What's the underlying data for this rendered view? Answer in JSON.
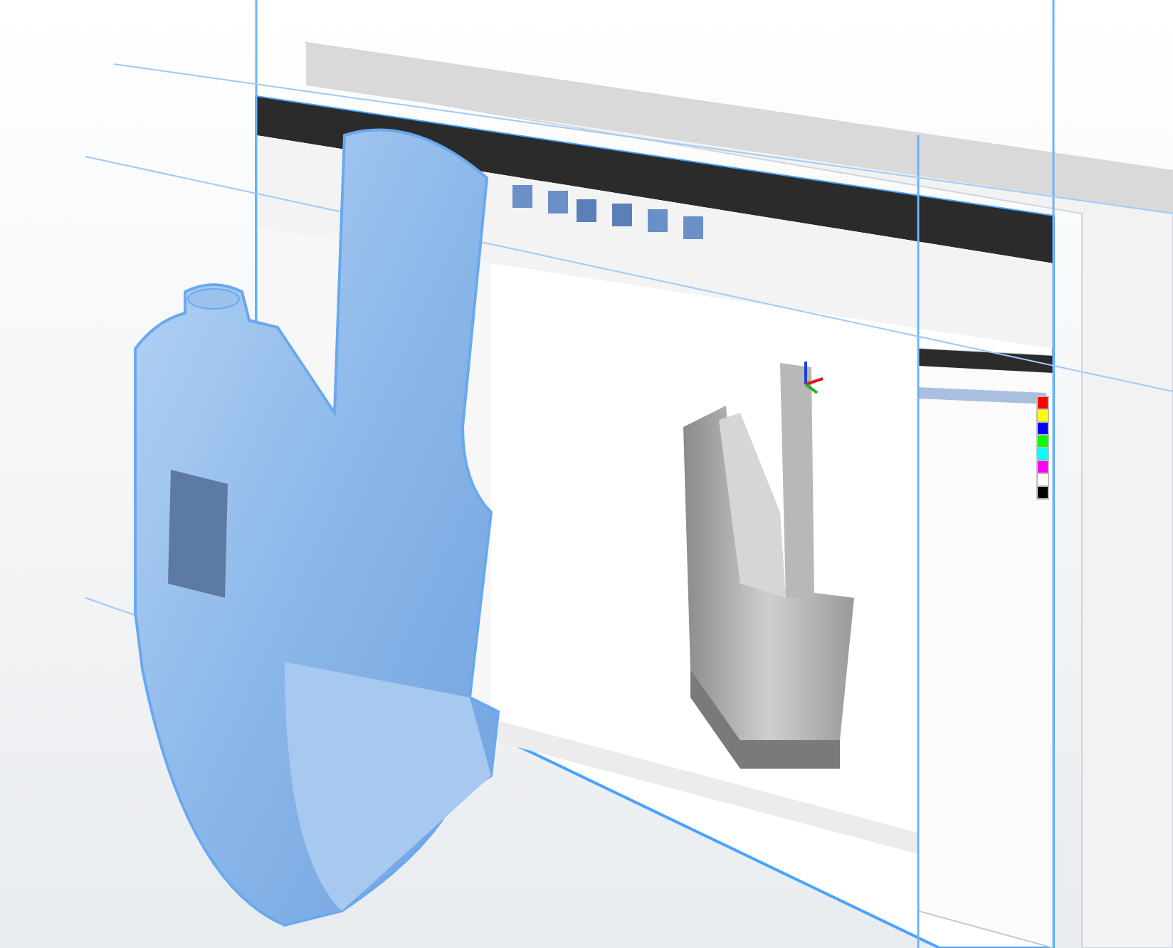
{
  "layer_panel": {
    "swatches": [
      {
        "color": "#ff0000"
      },
      {
        "color": "#ffff00"
      },
      {
        "color": "#0000ff"
      },
      {
        "color": "#00ff00"
      },
      {
        "color": "#00ffff"
      },
      {
        "color": "#ff00ff"
      },
      {
        "color": "#ffffff"
      },
      {
        "color": "#000000"
      }
    ]
  }
}
